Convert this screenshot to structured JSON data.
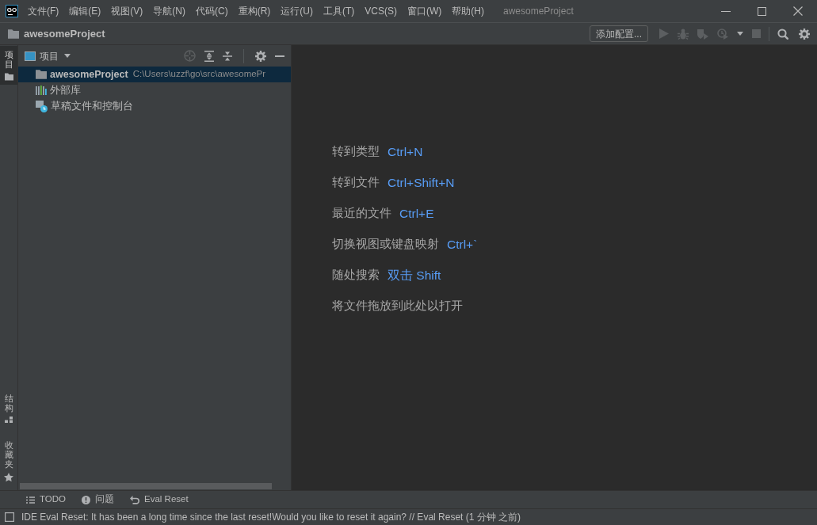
{
  "window": {
    "logo_text": "GO",
    "menu": [
      "文件(F)",
      "编辑(E)",
      "视图(V)",
      "导航(N)",
      "代码(C)",
      "重构(R)",
      "运行(U)",
      "工具(T)",
      "VCS(S)",
      "窗口(W)",
      "帮助(H)"
    ],
    "title": "awesomeProject"
  },
  "navigation_bar": {
    "breadcrumb": "awesomeProject",
    "run_config_button": "添加配置...",
    "run_toolbar": [
      {
        "kind": "run",
        "disabled": true
      },
      {
        "kind": "debug",
        "disabled": true
      },
      {
        "kind": "coverage",
        "disabled": true
      },
      {
        "kind": "profile",
        "disabled": true
      },
      {
        "kind": "dropdown",
        "disabled": false
      },
      {
        "kind": "stop",
        "disabled": true
      }
    ],
    "actions": [
      {
        "kind": "search",
        "disabled": false
      },
      {
        "kind": "settings",
        "disabled": false
      }
    ]
  },
  "left_stripe": {
    "top_tabs": [
      {
        "kind": "project",
        "label": "项目",
        "selected": true
      }
    ],
    "bottom_tabs": [
      {
        "kind": "structure",
        "label": "结构",
        "selected": false
      },
      {
        "kind": "favorites",
        "label": "收藏夹",
        "selected": false
      }
    ]
  },
  "project_panel": {
    "title": "项目",
    "header_actions": [
      {
        "kind": "locate",
        "disabled": true
      },
      {
        "kind": "expand_all",
        "disabled": false
      },
      {
        "kind": "collapse_all",
        "disabled": false
      },
      {
        "kind": "settings",
        "disabled": false
      },
      {
        "kind": "hide",
        "disabled": false
      }
    ],
    "tree": [
      {
        "kind": "project",
        "label": "awesomeProject",
        "path": "C:\\Users\\uzzf\\go\\src\\awesomePr",
        "selected": true
      },
      {
        "kind": "library",
        "label": "外部库",
        "selected": false
      },
      {
        "kind": "scratch",
        "label": "草稿文件和控制台",
        "selected": false
      }
    ]
  },
  "editor_hints": [
    {
      "action": "转到类型",
      "shortcut": "Ctrl+N"
    },
    {
      "action": "转到文件",
      "shortcut": "Ctrl+Shift+N"
    },
    {
      "action": "最近的文件",
      "shortcut": "Ctrl+E"
    },
    {
      "action": "切换视图或键盘映射",
      "shortcut": "Ctrl+`"
    },
    {
      "action": "随处搜索",
      "shortcut": "双击 Shift"
    },
    {
      "action": "将文件拖放到此处以打开"
    }
  ],
  "tool_window_bar": [
    {
      "kind": "todo",
      "label": "TODO"
    },
    {
      "kind": "problems",
      "label": "问题"
    },
    {
      "kind": "eval_reset",
      "label": "Eval Reset"
    }
  ],
  "status_bar": {
    "message": "IDE Eval Reset: It has been a long time since the last reset!Would you like to reset it again? // Eval Reset (1 分钟 之前)"
  }
}
